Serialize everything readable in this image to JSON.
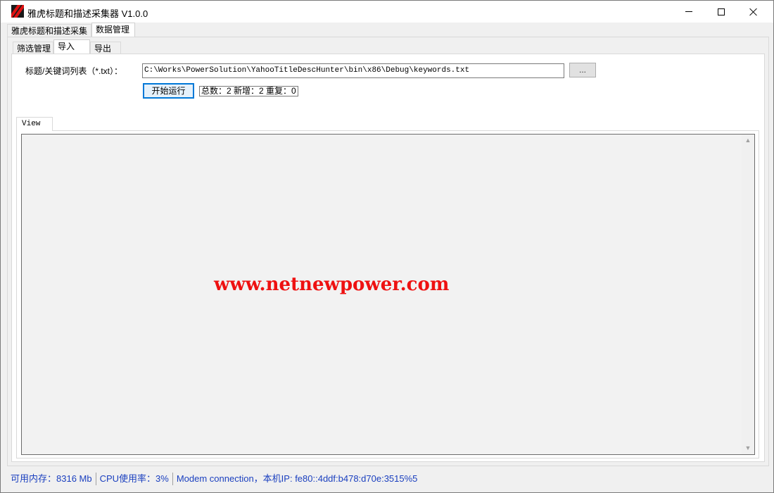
{
  "window": {
    "title": "雅虎标题和描述采集器 V1.0.0"
  },
  "main_tabs": [
    {
      "label": "雅虎标题和描述采集"
    },
    {
      "label": "数据管理"
    }
  ],
  "sub_tabs": [
    {
      "label": "筛选管理"
    },
    {
      "label": "导入"
    },
    {
      "label": "导出"
    }
  ],
  "import": {
    "file_label": "标题/关键词列表（*.txt）：",
    "file_path": "C:\\Works\\PowerSolution\\YahooTitleDescHunter\\bin\\x86\\Debug\\keywords.txt",
    "browse_label": "...",
    "run_label": "开始运行",
    "stats_text": "总数：2 新增：2 重复：0"
  },
  "view": {
    "tab_label": "View",
    "watermark": "www.netnewpower.com"
  },
  "statusbar": {
    "memory": "可用内存：8316 Mb",
    "cpu": "CPU使用率：3%",
    "network": "Modem connection，本机IP: fe80::4ddf:b478:d70e:3515%5"
  },
  "colors": {
    "status_text": "#1a3fbf",
    "watermark": "#ee1111",
    "focus_border": "#0078d7"
  }
}
